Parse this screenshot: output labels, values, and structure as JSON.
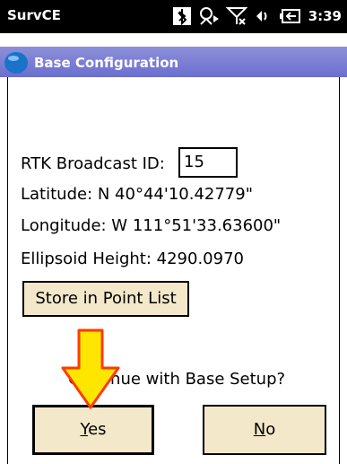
{
  "statusbar": {
    "app_title": "SurvCE",
    "clock": "3:39",
    "icons": [
      "bluetooth-icon",
      "network-sync-icon",
      "signal-off-icon",
      "volume-icon",
      "battery-icon"
    ]
  },
  "window": {
    "title": "Base Configuration",
    "title_color": "#ffffff",
    "title_bar_color": "#7b7ed4"
  },
  "form": {
    "broadcast_id_label": "RTK Broadcast ID:",
    "broadcast_id_value": "15",
    "latitude": "Latitude:  N 40°44'10.42779\"",
    "longitude": "Longitude:  W 111°51'33.63600\"",
    "ellipsoid_height": "Ellipsoid Height: 4290.0970"
  },
  "buttons": {
    "store_label": "Store in Point List",
    "yes_label_first": "Y",
    "yes_label_rest": "es",
    "no_label_first": "N",
    "no_label_rest": "o",
    "button_color": "#f3e8c9"
  },
  "prompt": {
    "question": "Continue with Base Setup?"
  },
  "annotation": {
    "arrow_color": "#ffe600",
    "arrow_outline": "#ff3b00"
  }
}
